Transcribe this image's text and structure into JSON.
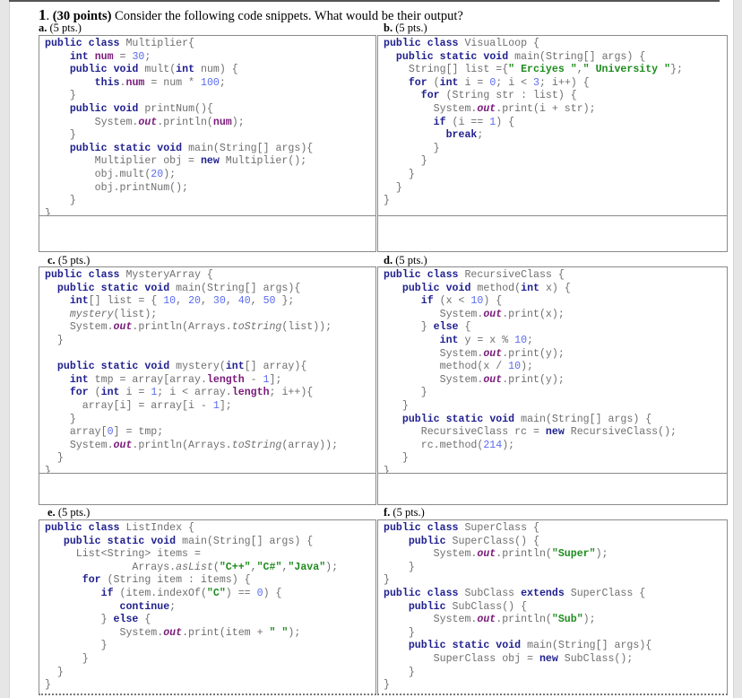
{
  "question": {
    "number": "1",
    "points": "(30 points)",
    "prompt": "Consider the following code snippets. What would be their output?"
  },
  "parts": [
    {
      "id": "a",
      "letter": "a.",
      "points": "(5 pts.)",
      "class_name": "Multiplier",
      "code": [
        "public class Multiplier{",
        "    int num = 30;",
        "    public void mult(int num) {",
        "        this.num = num * 100;",
        "    }",
        "    public void printNum(){",
        "        System.out.println(num);",
        "    }",
        "    public static void main(String[] args){",
        "        Multiplier obj = new Multiplier();",
        "        obj.mult(20);",
        "        obj.printNum();",
        "    }",
        "}"
      ],
      "answer": ""
    },
    {
      "id": "b",
      "letter": "b.",
      "points": "(5 pts.)",
      "class_name": "VisualLoop",
      "code": [
        "public class VisualLoop {",
        "  public static void main(String[] args) {",
        "    String[] list ={\" Erciyes \",\" University \"};",
        "    for (int i = 0; i < 3; i++) {",
        "      for (String str : list) {",
        "        System.out.print(i + str);",
        "        if (i == 1) {",
        "          break;",
        "        }",
        "      }",
        "    }",
        "  }",
        "}"
      ],
      "answer": ""
    },
    {
      "id": "c",
      "letter": "c.",
      "points": "(5 pts.)",
      "class_name": "MysteryArray",
      "code": [
        "public class MysteryArray {",
        "  public static void main(String[] args){",
        "    int[] list = { 10, 20, 30, 40, 50 };",
        "    mystery(list);",
        "    System.out.println(Arrays.toString(list));",
        "  }",
        "",
        "  public static void mystery(int[] array){",
        "    int tmp = array[array.length - 1];",
        "    for (int i = 1; i < array.length; i++){",
        "      array[i] = array[i - 1];",
        "    }",
        "    array[0] = tmp;",
        "    System.out.println(Arrays.toString(array));",
        "  }",
        "}"
      ],
      "answer": ""
    },
    {
      "id": "d",
      "letter": "d.",
      "points": "(5 pts.)",
      "class_name": "RecursiveClass",
      "code": [
        "public class RecursiveClass {",
        "   public void method(int x) {",
        "      if (x < 10) {",
        "         System.out.print(x);",
        "      } else {",
        "         int y = x % 10;",
        "         System.out.print(y);",
        "         method(x / 10);",
        "         System.out.print(y);",
        "      }",
        "   }",
        "   public static void main(String[] args) {",
        "      RecursiveClass rc = new RecursiveClass();",
        "      rc.method(214);",
        "   }",
        "}"
      ],
      "answer": ""
    },
    {
      "id": "e",
      "letter": "e.",
      "points": "(5 pts.)",
      "class_name": "ListIndex",
      "code": [
        "public class ListIndex {",
        "   public static void main(String[] args) {",
        "     List<String> items =",
        "              Arrays.asList(\"C++\",\"C#\",\"Java\");",
        "      for (String item : items) {",
        "         if (item.indexOf(\"C\") == 0) {",
        "            continue;",
        "         } else {",
        "            System.out.print(item + \" \");",
        "         }",
        "      }",
        "  }",
        "}"
      ],
      "answer": ""
    },
    {
      "id": "f",
      "letter": "f.",
      "points": "(5 pts.)",
      "class_name": "SuperClass / SubClass",
      "code": [
        "public class SuperClass {",
        "    public SuperClass() {",
        "        System.out.println(\"Super\");",
        "    }",
        "}",
        "public class SubClass extends SuperClass {",
        "    public SubClass() {",
        "        System.out.println(\"Sub\");",
        "    }",
        "    public static void main(String[] args){",
        "        SuperClass obj = new SubClass();",
        "    }",
        "}"
      ],
      "answer": ""
    }
  ],
  "syntax_colors": {
    "keyword": "#1f1f8f",
    "field": "#7a1a7a",
    "number": "#5a6cf0",
    "string": "#1e8c1e",
    "plain": "#6f6f6f"
  }
}
